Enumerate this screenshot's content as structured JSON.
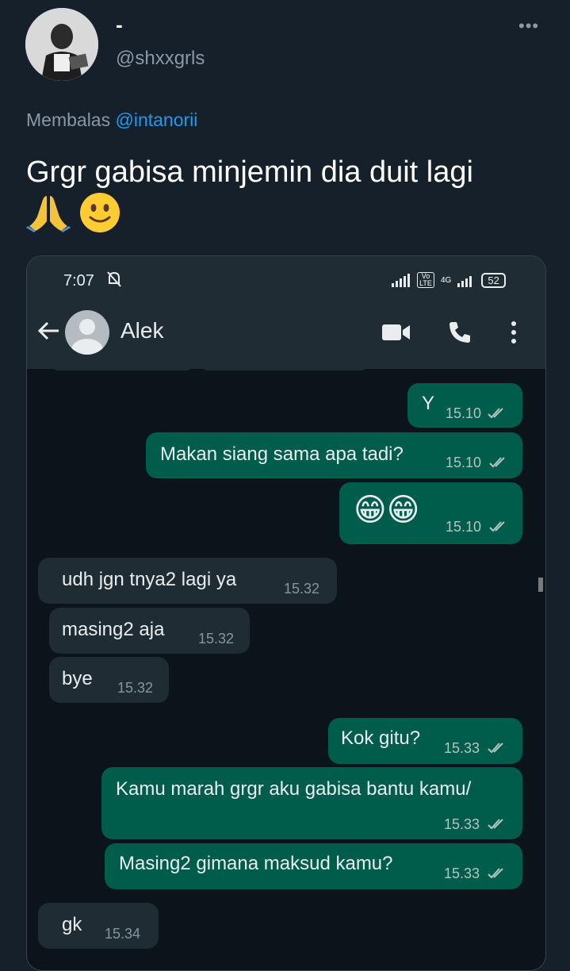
{
  "tweet": {
    "display_name": "-",
    "handle": "@shxxgrls",
    "more_label": "•••",
    "reply_prefix": "Membalas",
    "reply_mention": "@intanorii",
    "text": "Grgr gabisa minjemin dia duit lagi",
    "emoji": [
      "folded-hands",
      "slightly-smiling-face"
    ]
  },
  "phone": {
    "status_time": "7:07",
    "battery": "52",
    "network": "4G",
    "volte": "Vo LTE"
  },
  "chat": {
    "contact_name": "Alek",
    "messages": [
      {
        "dir": "out",
        "text": "Y",
        "time": "15.10"
      },
      {
        "dir": "out",
        "text": "Makan siang sama apa tadi?",
        "time": "15.10"
      },
      {
        "dir": "out",
        "text": "😁😁",
        "time": "15.10"
      },
      {
        "dir": "in",
        "text": "udh jgn tnya2 lagi ya",
        "time": "15.32"
      },
      {
        "dir": "in",
        "text": "masing2 aja",
        "time": "15.32"
      },
      {
        "dir": "in",
        "text": "bye",
        "time": "15.32"
      },
      {
        "dir": "out",
        "text": "Kok gitu?",
        "time": "15.33"
      },
      {
        "dir": "out",
        "text": "Kamu marah grgr aku gabisa bantu kamu/",
        "time": "15.33"
      },
      {
        "dir": "out",
        "text": "Masing2 gimana maksud kamu?",
        "time": "15.33"
      },
      {
        "dir": "in",
        "text": "gk",
        "time": "15.34"
      }
    ]
  },
  "colors": {
    "background": "#15202b",
    "outgoing_bubble": "#005c4b",
    "incoming_bubble": "#1f2c34",
    "mention": "#1d9bf0"
  }
}
